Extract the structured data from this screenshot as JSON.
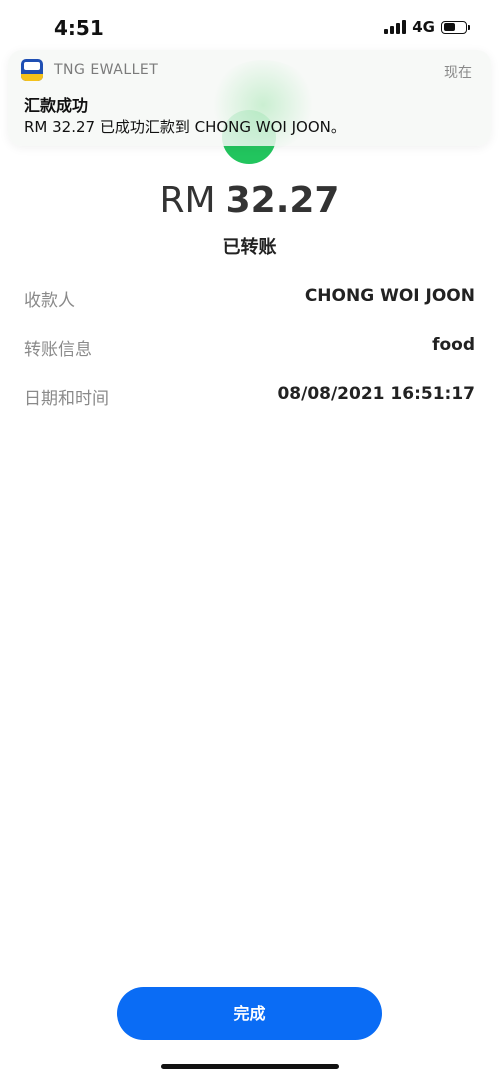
{
  "status_bar": {
    "time": "4:51",
    "network": "4G",
    "signal_bars": 4,
    "battery_level": 0.55
  },
  "notification": {
    "app_name": "TNG EWALLET",
    "time": "现在",
    "title": "汇款成功",
    "body": "RM 32.27 已成功汇款到 CHONG WOI JOON。"
  },
  "transfer": {
    "currency": "RM",
    "amount": "32.27",
    "status": "已转账",
    "details": [
      {
        "label": "收款人",
        "value": "CHONG WOI JOON"
      },
      {
        "label": "转账信息",
        "value": "food"
      },
      {
        "label": "日期和时间",
        "value": "08/08/2021 16:51:17"
      }
    ]
  },
  "actions": {
    "done_label": "完成"
  },
  "colors": {
    "accent": "#0a6cf5",
    "success": "#22c55e",
    "label_gray": "#8a8a8a"
  },
  "icons": {
    "success": "check-circle-icon",
    "app": "tng-ewallet-app-icon"
  }
}
